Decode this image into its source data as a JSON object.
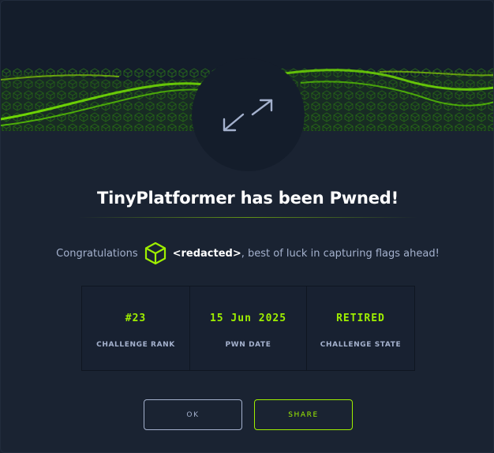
{
  "modal": {
    "title": "TinyPlatformer has been Pwned!",
    "congrats_prefix": "Congratulations",
    "user_name": "<redacted>",
    "congrats_suffix": ", best of luck in capturing flags ahead!",
    "badge_icon": "expand-arrows-icon",
    "user_icon": "cube-icon"
  },
  "stats": [
    {
      "value": "#23",
      "label": "CHALLENGE RANK"
    },
    {
      "value": "15 Jun 2025",
      "label": "PWN DATE"
    },
    {
      "value": "RETIRED",
      "label": "CHALLENGE STATE"
    }
  ],
  "buttons": {
    "ok": "OK",
    "share": "SHARE"
  },
  "colors": {
    "accent": "#9fef00",
    "background": "#1a2332",
    "muted_text": "#a4b1cd"
  }
}
